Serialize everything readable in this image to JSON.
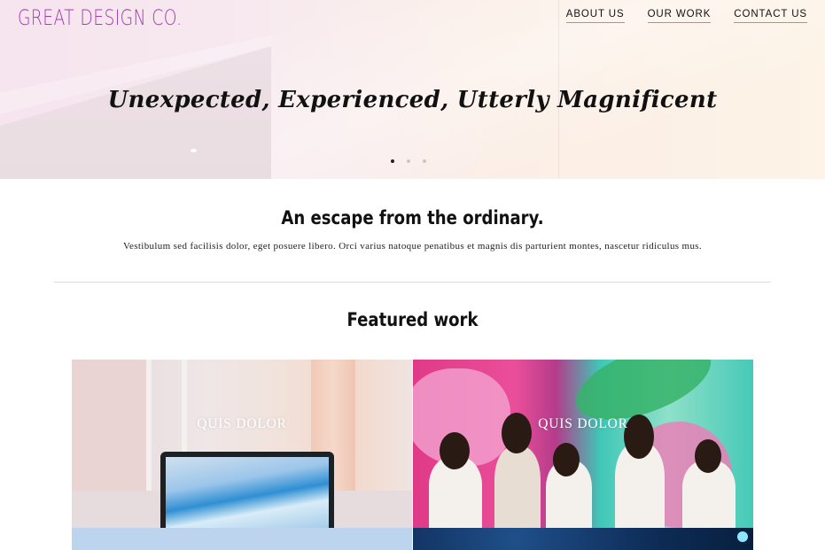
{
  "header": {
    "logo": "GREAT DESIGN CO.",
    "nav": [
      {
        "label": "ABOUT US"
      },
      {
        "label": "OUR WORK"
      },
      {
        "label": "CONTACT US"
      }
    ]
  },
  "hero": {
    "title": "Unexpected, Experienced, Utterly Magnificent",
    "slides_total": 3,
    "active_slide": 1
  },
  "intro": {
    "title": "An escape from the ordinary.",
    "text": "Vestibulum sed facilisis dolor, eget posuere libero. Orci varius natoque penatibus et magnis dis parturient montes, nascetur ridiculus mus."
  },
  "featured": {
    "title": "Featured work",
    "tiles": [
      {
        "label": "QUIS DOLOR"
      },
      {
        "label": "QUIS DOLOR"
      }
    ]
  },
  "colors": {
    "logo": "#a63bb3",
    "nav_underline": "#9a9a9a"
  }
}
